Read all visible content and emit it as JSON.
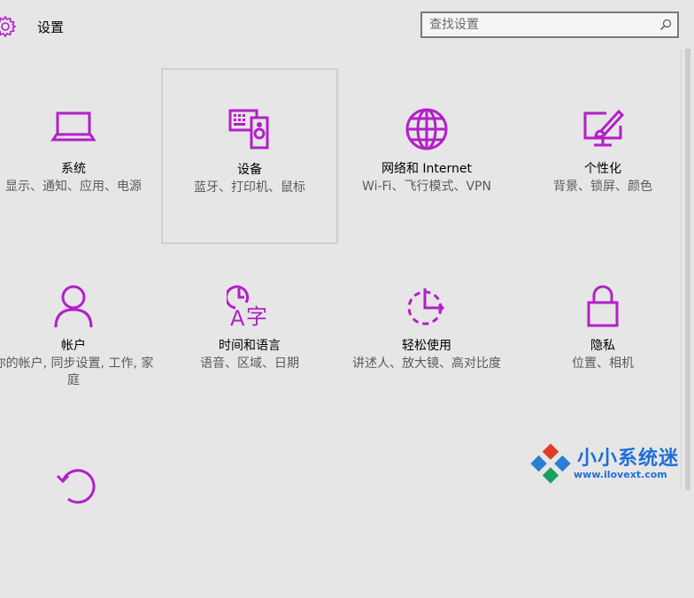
{
  "header": {
    "title": "设置",
    "search_placeholder": "查找设置"
  },
  "accent_color": "#b31fc8",
  "tiles": [
    {
      "icon": "laptop-icon",
      "name": "系统",
      "desc": "显示、通知、应用、电源"
    },
    {
      "icon": "devices-icon",
      "name": "设备",
      "desc": "蓝牙、打印机、鼠标"
    },
    {
      "icon": "globe-icon",
      "name": "网络和 Internet",
      "desc": "Wi-Fi、飞行模式、VPN"
    },
    {
      "icon": "personalization-icon",
      "name": "个性化",
      "desc": "背景、锁屏、颜色"
    },
    {
      "icon": "person-icon",
      "name": "帐户",
      "desc": "你的帐户, 同步设置, 工作, 家庭"
    },
    {
      "icon": "time-language-icon",
      "name": "时间和语言",
      "desc": "语音、区域、日期"
    },
    {
      "icon": "ease-of-access-icon",
      "name": "轻松使用",
      "desc": "讲述人、放大镜、高对比度"
    },
    {
      "icon": "lock-icon",
      "name": "隐私",
      "desc": "位置、相机"
    },
    {
      "icon": "update-icon",
      "name": "",
      "desc": ""
    }
  ],
  "watermark": {
    "text": "小小系统迷",
    "url": "www.ilovext.com"
  }
}
